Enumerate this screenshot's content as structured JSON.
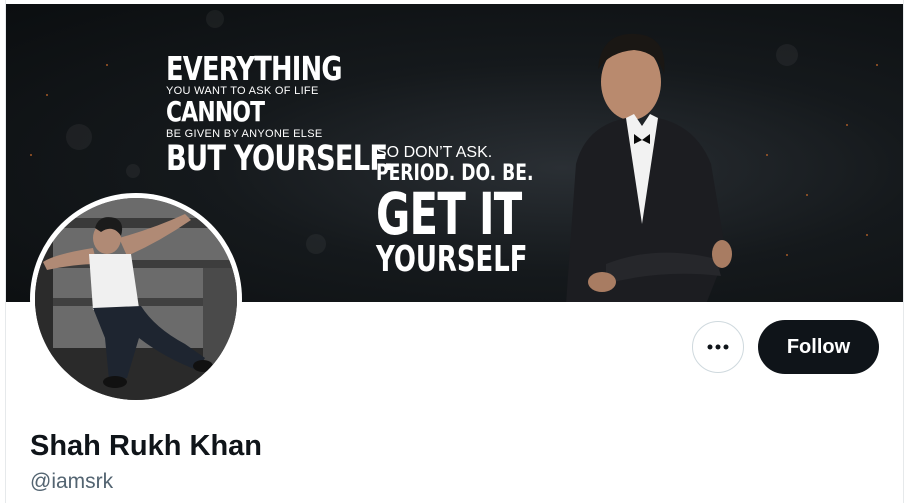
{
  "banner": {
    "quote_left": {
      "line1": "EVERYTHING",
      "line2": "YOU WANT TO ASK OF LIFE",
      "line3": "CANNOT",
      "line4": "BE GIVEN BY ANYONE ELSE",
      "line5": "BUT YOURSELF."
    },
    "quote_right": {
      "line1": "SO DON’T ASK.",
      "line2": "PERIOD. DO. BE.",
      "line3": "GET IT",
      "line4": "YOURSELF"
    },
    "background_color": "#0b0e10"
  },
  "profile": {
    "display_name": "Shah Rukh Khan",
    "handle": "@iamsrk"
  },
  "actions": {
    "follow_label": "Follow",
    "more_icon": "more-horizontal-icon"
  },
  "colors": {
    "primary_text": "#0f1419",
    "secondary_text": "#536471",
    "follow_bg": "#0f1419",
    "follow_text": "#ffffff",
    "border": "#cfd9de"
  }
}
